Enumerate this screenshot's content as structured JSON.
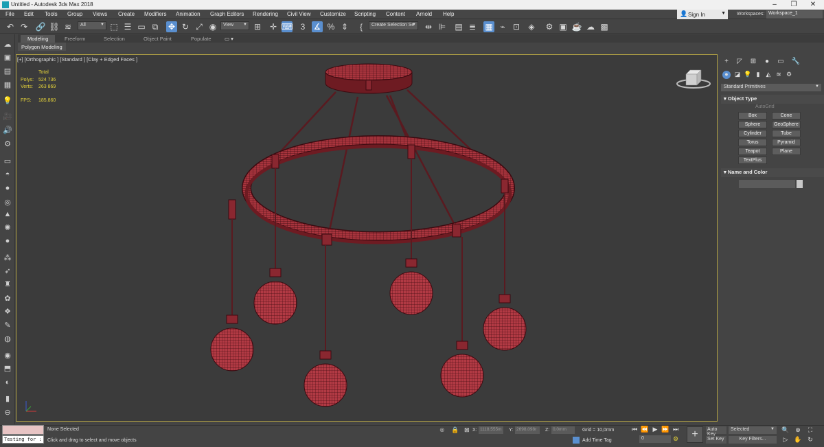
{
  "window": {
    "title": "Untitled - Autodesk 3ds Max 2018",
    "min": "–",
    "max": "❐",
    "close": "✕"
  },
  "menu": [
    "File",
    "Edit",
    "Tools",
    "Group",
    "Views",
    "Create",
    "Modifiers",
    "Animation",
    "Graph Editors",
    "Rendering",
    "Civil View",
    "Customize",
    "Scripting",
    "Content",
    "Arnold",
    "Help"
  ],
  "account": {
    "signin": "Sign In",
    "workspaces_label": "Workspaces:",
    "workspace": "Workspace_1"
  },
  "toolbar": {
    "filter": "All",
    "refcoord": "View",
    "selection_set": "Create Selection Se"
  },
  "ribbon": {
    "tabs": [
      "Modeling",
      "Freeform",
      "Selection",
      "Object Paint",
      "Populate"
    ],
    "active": "Modeling",
    "sub": "Polygon Modeling"
  },
  "viewport": {
    "label": "[+] [Orthographic ] [Standard ] [Clay + Edged Faces ]",
    "stats": {
      "total_label": "Total",
      "polys_label": "Polys:",
      "polys": "524 736",
      "verts_label": "Verts:",
      "verts": "263 869",
      "fps_label": "FPS:",
      "fps": "185,860"
    }
  },
  "command_panel": {
    "category": "Standard Primitives",
    "object_type_title": "Object Type",
    "autogrid": "AutoGrid",
    "primitives": [
      "Box",
      "Cone",
      "Sphere",
      "GeoSphere",
      "Cylinder",
      "Tube",
      "Torus",
      "Pyramid",
      "Teapot",
      "Plane",
      "TextPlus"
    ],
    "name_color_title": "Name and Color"
  },
  "status": {
    "maxscript": "Testing for :",
    "selection": "None Selected",
    "prompt": "Click and drag to select and move objects",
    "x_label": "X:",
    "x": "1118,555m",
    "y_label": "Y:",
    "y": "2698,098r",
    "z_label": "Z:",
    "z": "0,0mm",
    "grid": "Grid = 10,0mm",
    "add_time_tag": "Add Time Tag",
    "frame": "0",
    "auto_key": "Auto Key",
    "set_key": "Set Key",
    "selected": "Selected",
    "key_filters": "Key Filters..."
  },
  "colors": {
    "accent": "#5a8fcf",
    "viewport_border": "#b0a044",
    "model": "#b23a44",
    "stats": "#e4d23a"
  }
}
